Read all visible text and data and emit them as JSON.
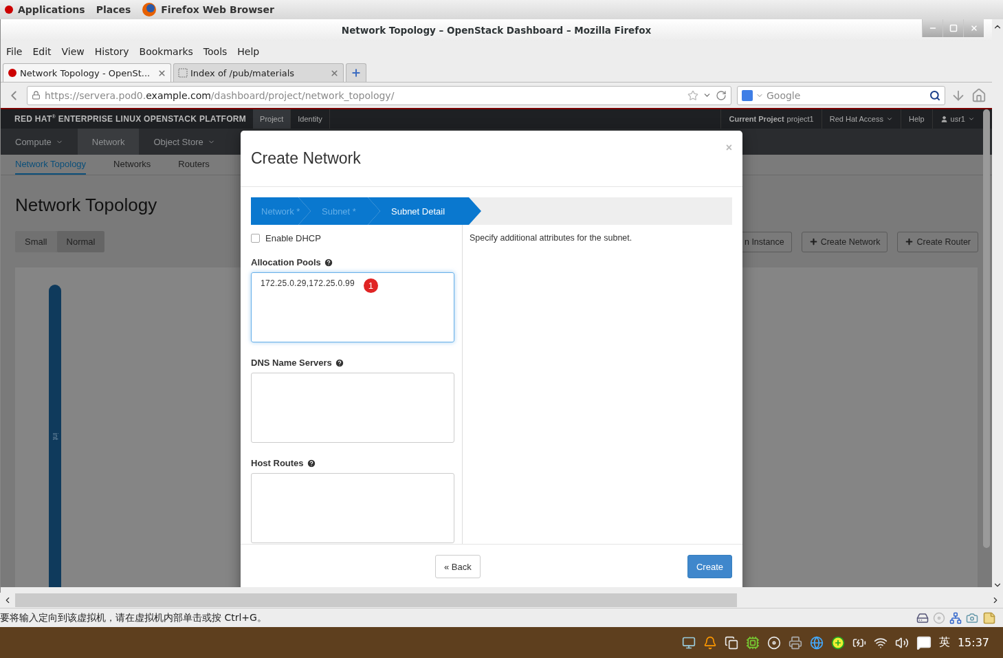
{
  "top_bar": {
    "menus": [
      "Applications",
      "Places"
    ],
    "app": "Firefox Web Browser"
  },
  "window": {
    "title": "Network Topology – OpenStack Dashboard – Mozilla Firefox"
  },
  "menu_bar": [
    "File",
    "Edit",
    "View",
    "History",
    "Bookmarks",
    "Tools",
    "Help"
  ],
  "tabs": [
    {
      "label": "Network Topology - OpenSt...",
      "selected": true
    },
    {
      "label": "Index of /pub/materials",
      "selected": false
    }
  ],
  "address": {
    "parts": [
      {
        "text": "https://servera.pod0.",
        "kind": "dim"
      },
      {
        "text": "example.com",
        "kind": "domain"
      },
      {
        "text": "/dashboard/project/network_topology/",
        "kind": "dim"
      }
    ]
  },
  "search": {
    "placeholder": "Google"
  },
  "dashboard": {
    "brand": "RED HAT$^{®}$ ENTERPRISE LINUX OPENSTACK PLATFORM",
    "top_tabs": [
      {
        "label": "Project",
        "selected": true
      },
      {
        "label": "Identity",
        "selected": false
      }
    ],
    "current_project": {
      "label": "Current Project",
      "value": "project1"
    },
    "right_menu": [
      {
        "label": "Red Hat Access",
        "dropdown": true
      },
      {
        "label": "Help",
        "dropdown": false
      }
    ],
    "user": "usr1",
    "nav": [
      {
        "label": "Compute",
        "selected": false,
        "dropdown": true
      },
      {
        "label": "Network",
        "selected": true,
        "dropdown": false
      },
      {
        "label": "Object Store",
        "selected": false,
        "dropdown": true
      }
    ],
    "subnav": [
      {
        "label": "Network Topology",
        "selected": true
      },
      {
        "label": "Networks",
        "selected": false
      },
      {
        "label": "Routers",
        "selected": false
      }
    ],
    "page_title": "Network Topology",
    "size_toggle": [
      {
        "label": "Small",
        "selected": false
      },
      {
        "label": "Normal",
        "selected": true
      }
    ],
    "actions": [
      {
        "label": "n Instance",
        "kind": "cut"
      },
      {
        "label": "Create Network",
        "kind": "add"
      },
      {
        "label": "Create Router",
        "kind": "add"
      }
    ],
    "topology": {
      "network_label": "int"
    }
  },
  "modal": {
    "title": "Create Network",
    "steps": [
      {
        "label": "Network *",
        "selected": false
      },
      {
        "label": "Subnet *",
        "selected": false
      },
      {
        "label": "Subnet Detail",
        "selected": true
      }
    ],
    "dhcp": {
      "label": "Enable DHCP",
      "checked": false
    },
    "fields": [
      {
        "label": "Allocation Pools",
        "value": "172.25.0.29,172.25.0.99",
        "badge": "1"
      },
      {
        "label": "DNS Name Servers"
      },
      {
        "label": "Host Routes"
      }
    ],
    "close": "×",
    "help_text": "Specify additional attributes for the subnet.",
    "back": "« Back",
    "submit": "Create"
  },
  "vm_status": {
    "message": "要将输入定向到该虚拟机，请在虚拟机内部单击或按 Ctrl+G。"
  },
  "taskbar": {
    "input_method": "英",
    "clock": "15:37"
  }
}
